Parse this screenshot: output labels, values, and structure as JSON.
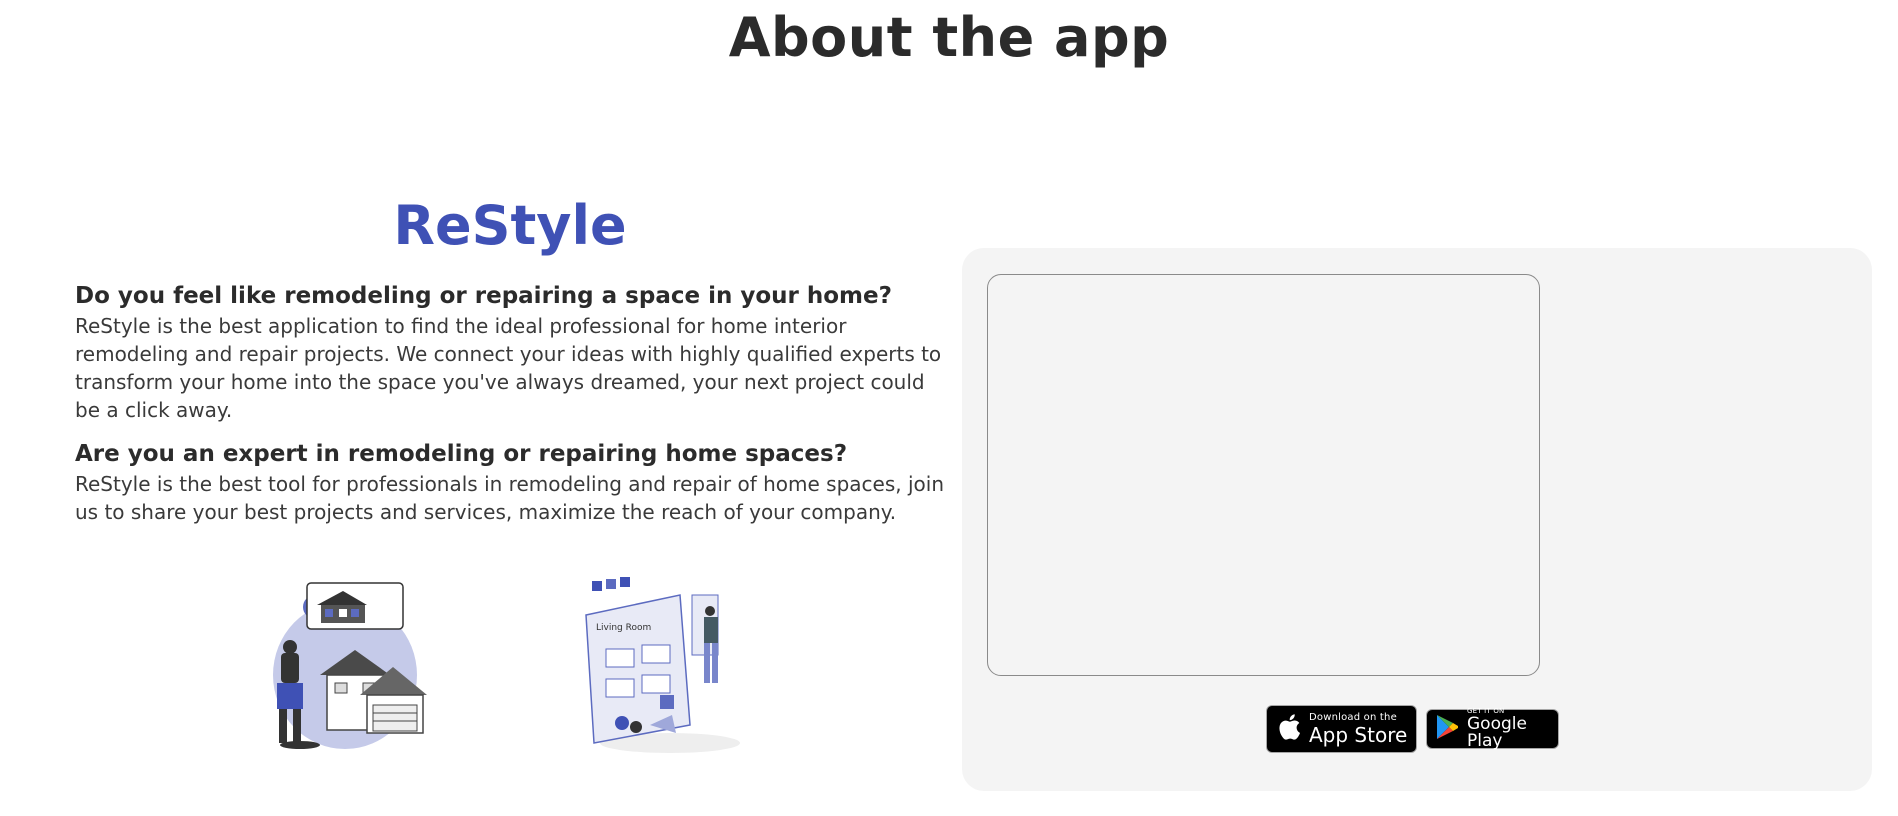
{
  "page_title": "About the app",
  "brand": "ReStyle",
  "sections": [
    {
      "heading": "Do you feel like remodeling or repairing a space in your home?",
      "body": "ReStyle is the best application to find the ideal professional for home interior remodeling and repair projects. We connect your ideas with highly qualified experts to transform your home into the space you've always dreamed, your next project could be a click away."
    },
    {
      "heading": "Are you an expert in remodeling or repairing home spaces?",
      "body": "ReStyle is the best tool for professionals in remodeling and repair of home spaces, join us to share your best projects and services, maximize the reach of your company."
    }
  ],
  "illustration_room_label": "Living Room",
  "store_buttons": {
    "app_store": {
      "small": "Download on the",
      "big": "App Store",
      "icon": "apple-icon"
    },
    "google_play": {
      "small": "GET IT ON",
      "big": "Google Play",
      "icon": "google-play-icon"
    }
  },
  "colors": {
    "brand": "#3f51b5",
    "illustration_accent": "#5c6bc0",
    "panel_bg": "#f4f4f4",
    "title_text": "#2b2b2b"
  }
}
